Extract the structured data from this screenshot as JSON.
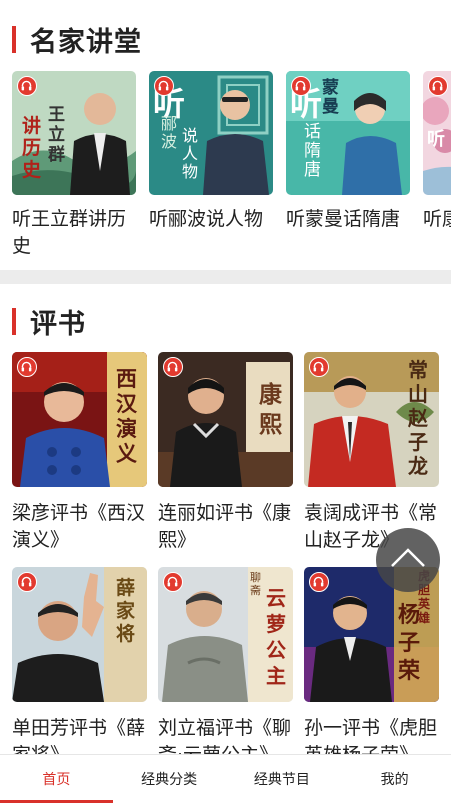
{
  "famous_lectures": {
    "title": "名家讲堂",
    "items": [
      {
        "caption": "听王立群讲历史",
        "cover_text": [
          "王立群",
          "讲历史"
        ]
      },
      {
        "caption": "听郦波说人物",
        "cover_text": [
          "听",
          "郦波",
          "说人物"
        ]
      },
      {
        "caption": "听蒙曼话隋唐",
        "cover_text": [
          "听",
          "蒙曼",
          "话隋唐"
        ]
      },
      {
        "caption": "听康震…",
        "cover_text": [
          "听"
        ]
      }
    ]
  },
  "storytelling": {
    "title": "评书",
    "items": [
      {
        "caption": "梁彦评书《西汉演义》",
        "cover_text": "西汉演义"
      },
      {
        "caption": "连丽如评书《康熙》",
        "cover_text": "康熙"
      },
      {
        "caption": "袁阔成评书《常山赵子龙》",
        "cover_text": "常山赵子龙"
      },
      {
        "caption": "单田芳评书《薛家将》",
        "cover_text": "薛家将"
      },
      {
        "caption": "刘立福评书《聊斋·云萝公主》",
        "cover_text": "云萝公主",
        "cover_small": "聊斋"
      },
      {
        "caption": "孙一评书《虎胆英雄杨子荣》",
        "cover_text": "杨子荣",
        "cover_small": "虎胆英雄"
      }
    ]
  },
  "tabbar": {
    "tabs": [
      {
        "label": "首页",
        "active": true
      },
      {
        "label": "经典分类",
        "active": false
      },
      {
        "label": "经典节目",
        "active": false
      },
      {
        "label": "我的",
        "active": false
      }
    ]
  },
  "icons": {
    "badge": "headphones-icon",
    "scroll_top": "chevron-up-icon"
  },
  "colors": {
    "accent": "#d9312a",
    "badge": "#e23a2f"
  }
}
